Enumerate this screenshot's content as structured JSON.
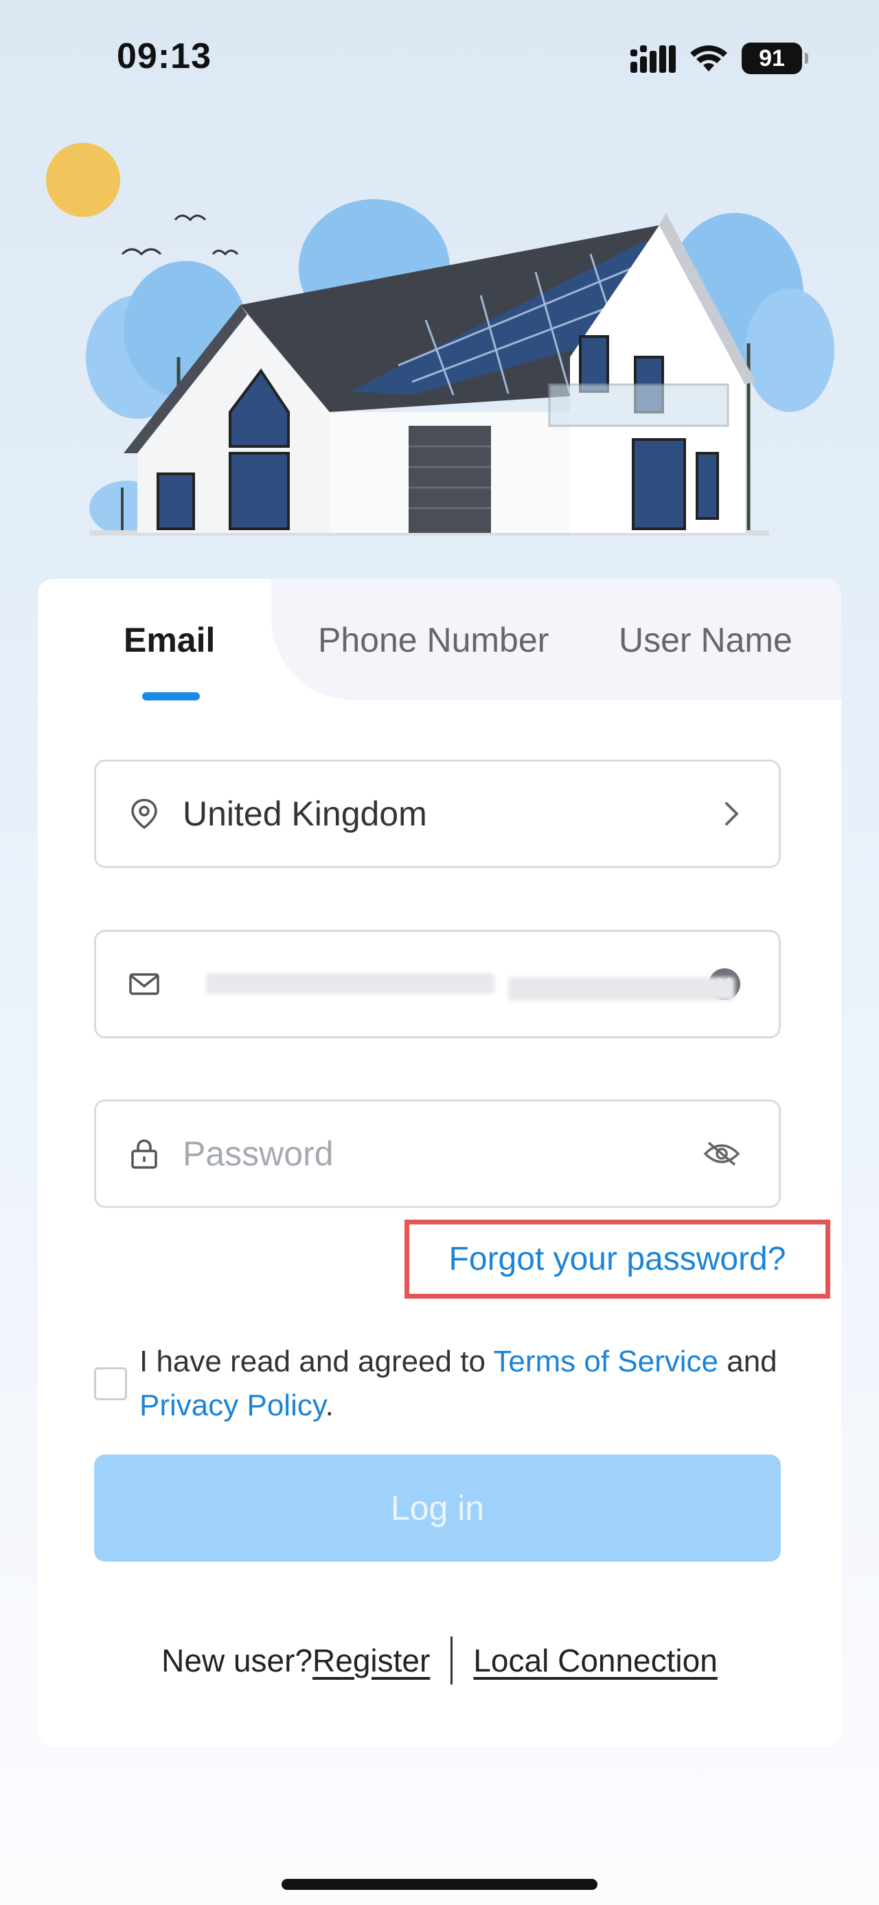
{
  "status_bar": {
    "time": "09:13",
    "battery": "91",
    "icons": [
      "signal-icon",
      "wifi-icon",
      "battery-icon"
    ]
  },
  "illustration": {
    "description_icon": "house-with-solar-panels-illustration"
  },
  "tabs": [
    {
      "label": "Email",
      "active": true
    },
    {
      "label": "Phone Number",
      "active": false
    },
    {
      "label": "User Name",
      "active": false
    }
  ],
  "region_field": {
    "value": "United Kingdom",
    "icon": "location-pin-icon",
    "trail_icon": "chevron-right-icon"
  },
  "email_field": {
    "value": "",
    "icon": "mail-icon",
    "trail_icon": "clear-icon"
  },
  "password_field": {
    "placeholder": "Password",
    "icon": "lock-icon",
    "trail_icon": "eye-hidden-icon"
  },
  "forgot_password": "Forgot your password?",
  "agreement": {
    "prefix": "I have read and agreed to ",
    "terms": "Terms of Service",
    "middle": " and",
    "privacy": "Privacy Policy",
    "suffix": "."
  },
  "login_button": "Log in",
  "footer": {
    "new_user": "New user? ",
    "register": "Register",
    "local_connection": "Local Connection"
  },
  "colors": {
    "accent": "#1b8be6",
    "link": "#1b84d6",
    "login_disabled": "#9fd2fb",
    "highlight_box": "#e55556"
  }
}
